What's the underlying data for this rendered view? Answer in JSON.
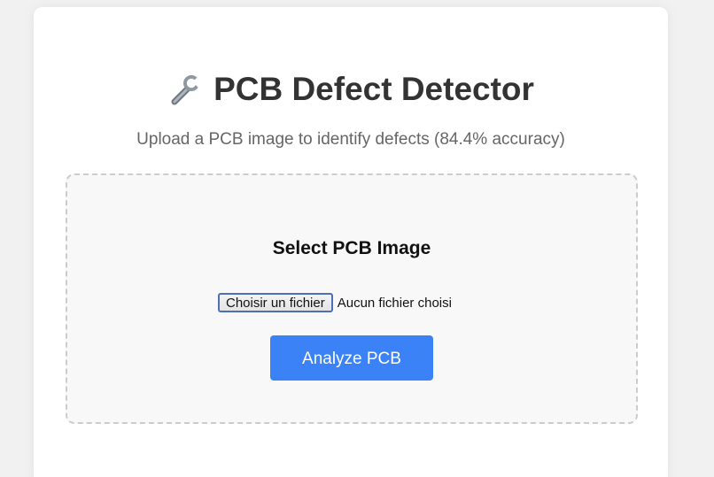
{
  "header": {
    "icon": "wrench-icon",
    "title": "PCB Defect Detector",
    "subtitle": "Upload a PCB image to identify defects (84.4% accuracy)"
  },
  "upload": {
    "heading": "Select PCB Image",
    "file_button_label": "Choisir un fichier",
    "file_status": "Aucun fichier choisi",
    "analyze_label": "Analyze PCB"
  },
  "colors": {
    "accent": "#3b82f6",
    "title": "#333333",
    "subtitle": "#666666",
    "upload_box_bg": "#f8f8f8",
    "upload_box_border": "#cccccc"
  }
}
